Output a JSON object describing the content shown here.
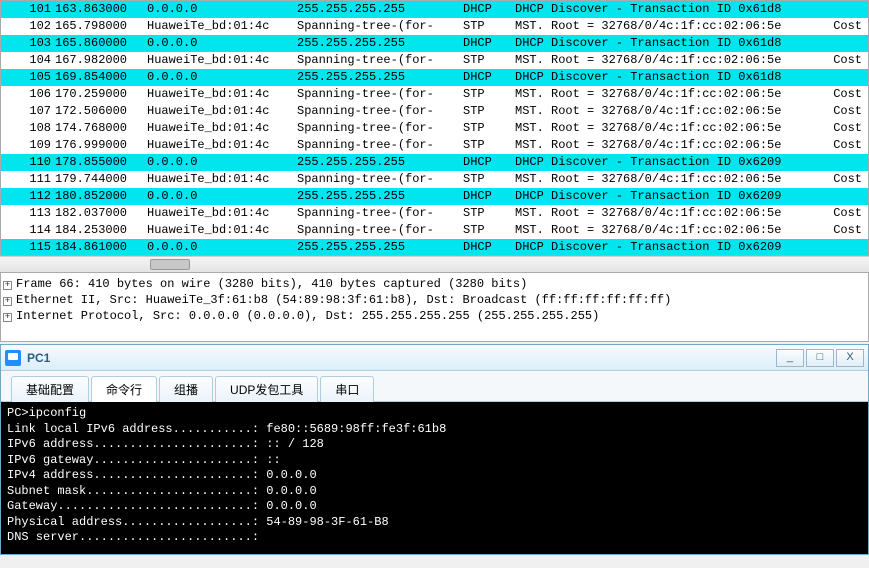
{
  "packets": [
    {
      "no": "101",
      "time": "163.863000",
      "src": "0.0.0.0",
      "dst": "255.255.255.255",
      "proto": "DHCP",
      "info": "DHCP Discover - Transaction ID 0x61d8",
      "extra": "",
      "hl": true
    },
    {
      "no": "102",
      "time": "165.798000",
      "src": "HuaweiTe_bd:01:4c",
      "dst": "Spanning-tree-(for-",
      "proto": "STP",
      "info": "MST. Root = 32768/0/4c:1f:cc:02:06:5e",
      "extra": "Cost",
      "hl": false
    },
    {
      "no": "103",
      "time": "165.860000",
      "src": "0.0.0.0",
      "dst": "255.255.255.255",
      "proto": "DHCP",
      "info": "DHCP Discover - Transaction ID 0x61d8",
      "extra": "",
      "hl": true
    },
    {
      "no": "104",
      "time": "167.982000",
      "src": "HuaweiTe_bd:01:4c",
      "dst": "Spanning-tree-(for-",
      "proto": "STP",
      "info": "MST. Root = 32768/0/4c:1f:cc:02:06:5e",
      "extra": "Cost",
      "hl": false
    },
    {
      "no": "105",
      "time": "169.854000",
      "src": "0.0.0.0",
      "dst": "255.255.255.255",
      "proto": "DHCP",
      "info": "DHCP Discover - Transaction ID 0x61d8",
      "extra": "",
      "hl": true
    },
    {
      "no": "106",
      "time": "170.259000",
      "src": "HuaweiTe_bd:01:4c",
      "dst": "Spanning-tree-(for-",
      "proto": "STP",
      "info": "MST. Root = 32768/0/4c:1f:cc:02:06:5e",
      "extra": "Cost",
      "hl": false
    },
    {
      "no": "107",
      "time": "172.506000",
      "src": "HuaweiTe_bd:01:4c",
      "dst": "Spanning-tree-(for-",
      "proto": "STP",
      "info": "MST. Root = 32768/0/4c:1f:cc:02:06:5e",
      "extra": "Cost",
      "hl": false
    },
    {
      "no": "108",
      "time": "174.768000",
      "src": "HuaweiTe_bd:01:4c",
      "dst": "Spanning-tree-(for-",
      "proto": "STP",
      "info": "MST. Root = 32768/0/4c:1f:cc:02:06:5e",
      "extra": "Cost",
      "hl": false
    },
    {
      "no": "109",
      "time": "176.999000",
      "src": "HuaweiTe_bd:01:4c",
      "dst": "Spanning-tree-(for-",
      "proto": "STP",
      "info": "MST. Root = 32768/0/4c:1f:cc:02:06:5e",
      "extra": "Cost",
      "hl": false
    },
    {
      "no": "110",
      "time": "178.855000",
      "src": "0.0.0.0",
      "dst": "255.255.255.255",
      "proto": "DHCP",
      "info": "DHCP Discover - Transaction ID 0x6209",
      "extra": "",
      "hl": true
    },
    {
      "no": "111",
      "time": "179.744000",
      "src": "HuaweiTe_bd:01:4c",
      "dst": "Spanning-tree-(for-",
      "proto": "STP",
      "info": "MST. Root = 32768/0/4c:1f:cc:02:06:5e",
      "extra": "Cost",
      "hl": false
    },
    {
      "no": "112",
      "time": "180.852000",
      "src": "0.0.0.0",
      "dst": "255.255.255.255",
      "proto": "DHCP",
      "info": "DHCP Discover - Transaction ID 0x6209",
      "extra": "",
      "hl": true
    },
    {
      "no": "113",
      "time": "182.037000",
      "src": "HuaweiTe_bd:01:4c",
      "dst": "Spanning-tree-(for-",
      "proto": "STP",
      "info": "MST. Root = 32768/0/4c:1f:cc:02:06:5e",
      "extra": "Cost",
      "hl": false
    },
    {
      "no": "114",
      "time": "184.253000",
      "src": "HuaweiTe_bd:01:4c",
      "dst": "Spanning-tree-(for-",
      "proto": "STP",
      "info": "MST. Root = 32768/0/4c:1f:cc:02:06:5e",
      "extra": "Cost",
      "hl": false
    },
    {
      "no": "115",
      "time": "184.861000",
      "src": "0.0.0.0",
      "dst": "255.255.255.255",
      "proto": "DHCP",
      "info": "DHCP Discover - Transaction ID 0x6209",
      "extra": "",
      "hl": true
    }
  ],
  "details": {
    "l1": "Frame 66: 410 bytes on wire (3280 bits), 410 bytes captured (3280 bits)",
    "l2": "Ethernet II, Src: HuaweiTe_3f:61:b8 (54:89:98:3f:61:b8), Dst: Broadcast (ff:ff:ff:ff:ff:ff)",
    "l3": "Internet Protocol, Src: 0.0.0.0 (0.0.0.0), Dst: 255.255.255.255 (255.255.255.255)"
  },
  "pc": {
    "title": "PC1",
    "winbtns": {
      "min": "_",
      "max": "□",
      "close": "X"
    },
    "tabs": {
      "basic": "基础配置",
      "cli": "命令行",
      "mcast": "组播",
      "udp": "UDP发包工具",
      "serial": "串口"
    },
    "terminal": {
      "prompt": "PC>ipconfig",
      "blank": "",
      "llv6": "Link local IPv6 address...........: fe80::5689:98ff:fe3f:61b8",
      "v6addr": "IPv6 address......................: :: / 128",
      "v6gw": "IPv6 gateway......................: ::",
      "v4addr": "IPv4 address......................: 0.0.0.0",
      "mask": "Subnet mask.......................: 0.0.0.0",
      "gw": "Gateway...........................: 0.0.0.0",
      "mac": "Physical address..................: 54-89-98-3F-61-B8",
      "dns": "DNS server........................:"
    }
  }
}
